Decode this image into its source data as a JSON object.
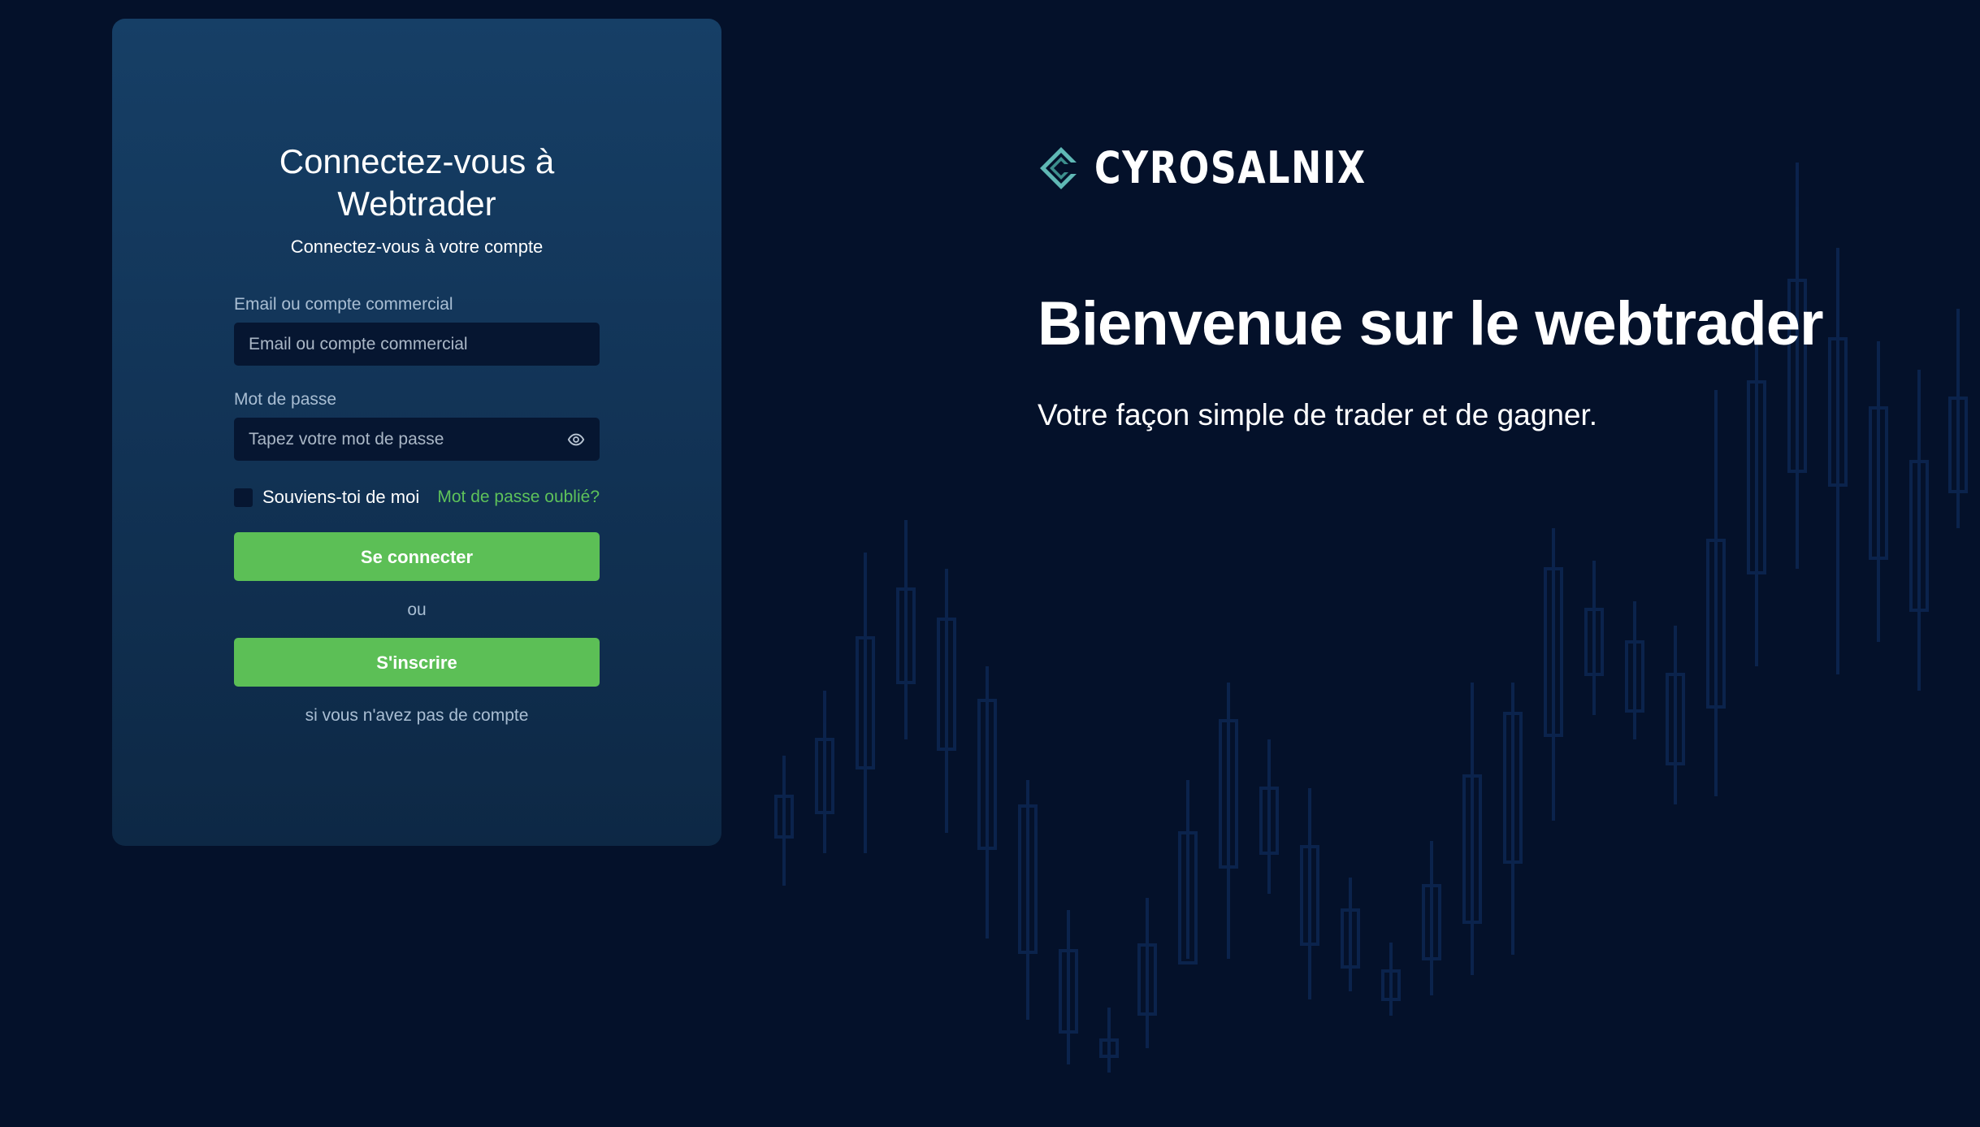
{
  "login": {
    "title_line1": "Connectez-vous à",
    "title_line2": "Webtrader",
    "subtitle": "Connectez-vous à votre compte",
    "email_label": "Email ou compte commercial",
    "email_placeholder": "Email ou compte commercial",
    "password_label": "Mot de passe",
    "password_placeholder": "Tapez votre mot de passe",
    "remember_label": "Souviens-toi de moi",
    "forgot_link": "Mot de passe oublié?",
    "login_button": "Se connecter",
    "or_text": "ou",
    "register_button": "S'inscrire",
    "register_hint": "si vous n'avez pas de compte"
  },
  "hero": {
    "brand": "CYROSALNIX",
    "headline": "Bienvenue sur le webtrader",
    "tagline": "Votre façon simple de trader et de gagner."
  },
  "icons": {
    "password_toggle": "eye-icon",
    "brand_logo": "logo-icon"
  },
  "colors": {
    "background": "#04112a",
    "panel": "#143a5f",
    "accent": "#5cbf56",
    "input": "#061631",
    "logo": "#5fb8b5"
  }
}
